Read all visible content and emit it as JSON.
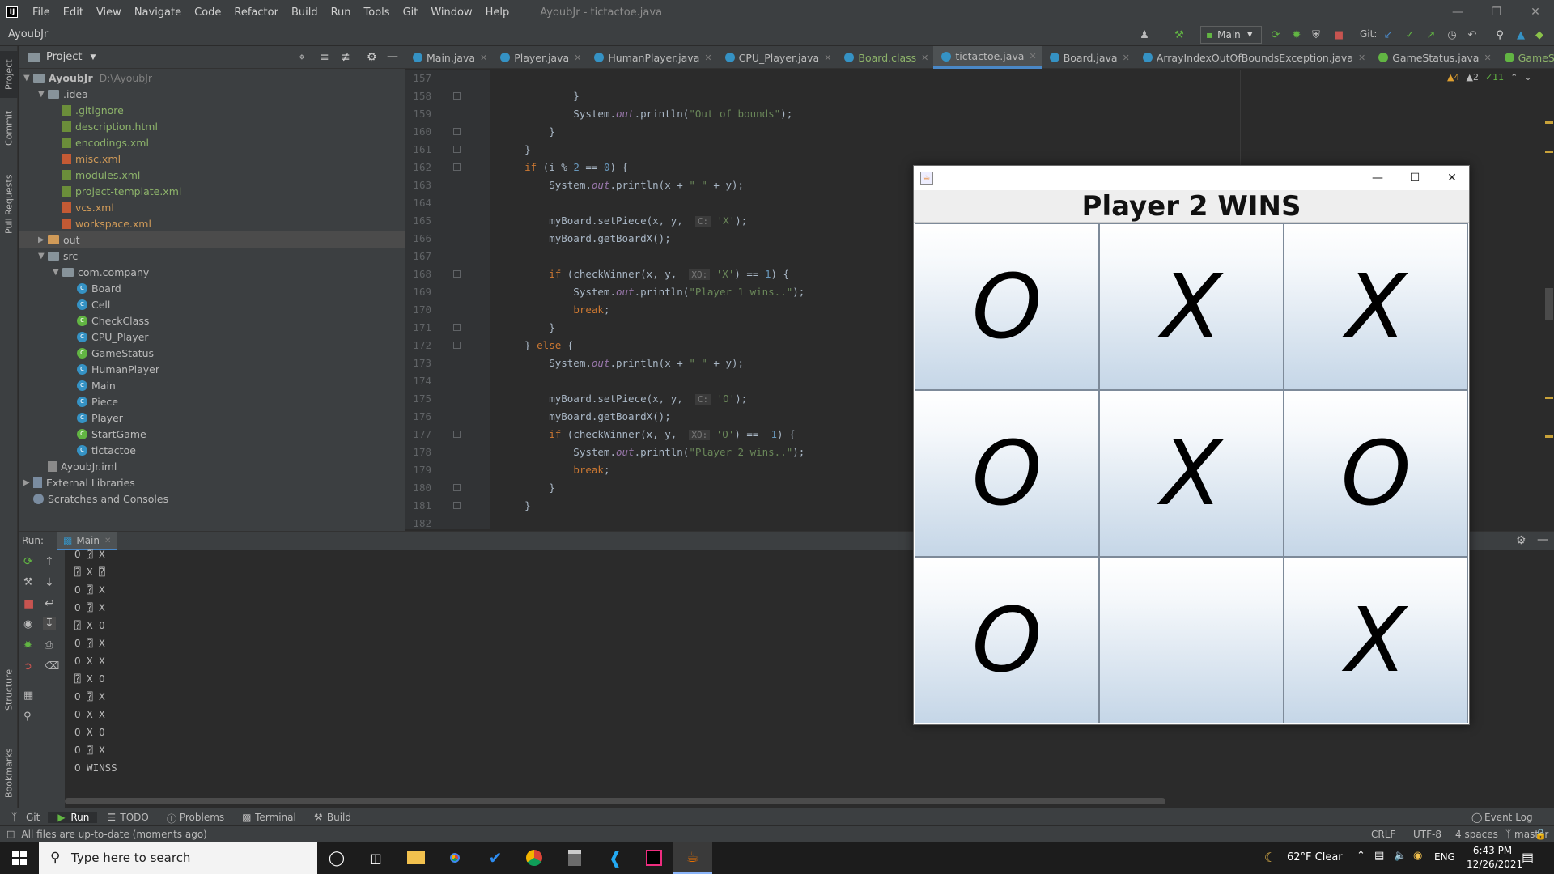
{
  "menubar": {
    "logo": "IJ",
    "items": [
      "File",
      "Edit",
      "View",
      "Navigate",
      "Code",
      "Refactor",
      "Build",
      "Run",
      "Tools",
      "Git",
      "Window",
      "Help"
    ],
    "window_title": "AyoubJr - tictactoe.java"
  },
  "toolbar": {
    "project_name": "AyoubJr",
    "run_config": "Main",
    "git_label": "Git:"
  },
  "left_strip": {
    "project": "Project",
    "commit": "Commit",
    "pull_requests": "Pull Requests",
    "structure": "Structure",
    "bookmarks": "Bookmarks"
  },
  "project_panel": {
    "title": "Project",
    "tree": [
      {
        "label": "AyoubJr",
        "extra": "D:\\AyoubJr",
        "type": "root"
      },
      {
        "label": ".idea",
        "type": "folder"
      },
      {
        "label": ".gitignore",
        "type": "file"
      },
      {
        "label": "description.html",
        "type": "file"
      },
      {
        "label": "encodings.xml",
        "type": "file"
      },
      {
        "label": "misc.xml",
        "type": "xml"
      },
      {
        "label": "modules.xml",
        "type": "file"
      },
      {
        "label": "project-template.xml",
        "type": "file"
      },
      {
        "label": "vcs.xml",
        "type": "xml"
      },
      {
        "label": "workspace.xml",
        "type": "xml"
      },
      {
        "label": "out",
        "type": "folder-orange"
      },
      {
        "label": "src",
        "type": "folder"
      },
      {
        "label": "com.company",
        "type": "folder"
      },
      {
        "label": "Board",
        "type": "class"
      },
      {
        "label": "Cell",
        "type": "class"
      },
      {
        "label": "CheckClass",
        "type": "class-green"
      },
      {
        "label": "CPU_Player",
        "type": "class"
      },
      {
        "label": "GameStatus",
        "type": "class-green"
      },
      {
        "label": "HumanPlayer",
        "type": "class"
      },
      {
        "label": "Main",
        "type": "class"
      },
      {
        "label": "Piece",
        "type": "class"
      },
      {
        "label": "Player",
        "type": "class"
      },
      {
        "label": "StartGame",
        "type": "class-green"
      },
      {
        "label": "tictactoe",
        "type": "class"
      },
      {
        "label": "AyoubJr.iml",
        "type": "iml"
      },
      {
        "label": "External Libraries",
        "type": "lib"
      },
      {
        "label": "Scratches and Consoles",
        "type": "scratch"
      }
    ]
  },
  "tabs": [
    {
      "label": "Main.java",
      "green": false,
      "active": false
    },
    {
      "label": "Player.java",
      "green": false,
      "active": false
    },
    {
      "label": "HumanPlayer.java",
      "green": false,
      "active": false
    },
    {
      "label": "CPU_Player.java",
      "green": false,
      "active": false
    },
    {
      "label": "Board.class",
      "green": true,
      "active": false
    },
    {
      "label": "tictactoe.java",
      "green": false,
      "active": true
    },
    {
      "label": "Board.java",
      "green": false,
      "active": false
    },
    {
      "label": "ArrayIndexOutOfBoundsException.java",
      "green": false,
      "active": false
    },
    {
      "label": "GameStatus.java",
      "green": false,
      "active": false
    },
    {
      "label": "GameStatus.class",
      "green": true,
      "active": false
    }
  ],
  "inspections": {
    "warn1": "4",
    "warn2": "2",
    "ok": "11"
  },
  "code_lines": [
    {
      "n": "157",
      "html": ""
    },
    {
      "n": "158",
      "html": "            }"
    },
    {
      "n": "159",
      "html": "            System.<span class=\"out\">out</span>.println(<span class=\"str\">\"Out of bounds\"</span>);"
    },
    {
      "n": "160",
      "html": "        }"
    },
    {
      "n": "161",
      "html": "    }"
    },
    {
      "n": "162",
      "html": "    <span class=\"kw\">if</span> (i % <span class=\"num-lit\">2</span> == <span class=\"num-lit\">0</span>) {"
    },
    {
      "n": "163",
      "html": "        System.<span class=\"out\">out</span>.println(x + <span class=\"str\">\" \"</span> + y);"
    },
    {
      "n": "164",
      "html": ""
    },
    {
      "n": "165",
      "html": "        myBoard.setPiece(x, y,  <span class=\"hint\">C:</span> <span class=\"str\">'X'</span>);"
    },
    {
      "n": "166",
      "html": "        myBoard.getBoardX();"
    },
    {
      "n": "167",
      "html": ""
    },
    {
      "n": "168",
      "html": "        <span class=\"kw\">if</span> (checkWinner(x, y,  <span class=\"hint\">XO:</span> <span class=\"str\">'X'</span>) == <span class=\"num-lit\">1</span>) {"
    },
    {
      "n": "169",
      "html": "            System.<span class=\"out\">out</span>.println(<span class=\"str\">\"Player 1 wins..\"</span>);"
    },
    {
      "n": "170",
      "html": "            <span class=\"kw\">break</span>;"
    },
    {
      "n": "171",
      "html": "        }"
    },
    {
      "n": "172",
      "html": "    } <span class=\"kw\">else</span> {"
    },
    {
      "n": "173",
      "html": "        System.<span class=\"out\">out</span>.println(x + <span class=\"str\">\" \"</span> + y);"
    },
    {
      "n": "174",
      "html": ""
    },
    {
      "n": "175",
      "html": "        myBoard.setPiece(x, y,  <span class=\"hint\">C:</span> <span class=\"str\">'O'</span>);"
    },
    {
      "n": "176",
      "html": "        myBoard.getBoardX();"
    },
    {
      "n": "177",
      "html": "        <span class=\"kw\">if</span> (checkWinner(x, y,  <span class=\"hint\">XO:</span> <span class=\"str\">'O'</span>) == -<span class=\"num-lit\">1</span>) {"
    },
    {
      "n": "178",
      "html": "            System.<span class=\"out\">out</span>.println(<span class=\"str\">\"Player 2 wins..\"</span>);"
    },
    {
      "n": "179",
      "html": "            <span class=\"kw\">break</span>;"
    },
    {
      "n": "180",
      "html": "        }"
    },
    {
      "n": "181",
      "html": "    }"
    },
    {
      "n": "182",
      "html": ""
    }
  ],
  "run_panel": {
    "label": "Run:",
    "tab": "Main",
    "console": [
      "O ⍰ X",
      "⍰ X ⍰",
      "O ⍰ X",
      "O ⍰ X",
      "⍰ X O",
      "O ⍰ X",
      "O X X",
      "⍰ X O",
      "O ⍰ X",
      "O X X",
      "O X O",
      "O ⍰ X",
      "O WINSS"
    ]
  },
  "bottom_tools": {
    "git": "Git",
    "run": "Run",
    "todo": "TODO",
    "problems": "Problems",
    "terminal": "Terminal",
    "build": "Build",
    "event_log": "Event Log"
  },
  "statusbar": {
    "message": "All files are up-to-date (moments ago)",
    "line_sep": "CRLF",
    "encoding": "UTF-8",
    "indent": "4 spaces",
    "branch": "master"
  },
  "taskbar": {
    "search_placeholder": "Type here to search",
    "weather": "62°F  Clear",
    "lang": "ENG",
    "time": "6:43 PM",
    "date": "12/26/2021"
  },
  "game": {
    "status": "Player 2 WINS",
    "board": [
      "O",
      "X",
      "X",
      "O",
      "X",
      "O",
      "O",
      "",
      "X"
    ]
  },
  "colors": {
    "ide_bg": "#2b2b2b",
    "panel_bg": "#3c3f41",
    "accent": "#4a88c7"
  }
}
